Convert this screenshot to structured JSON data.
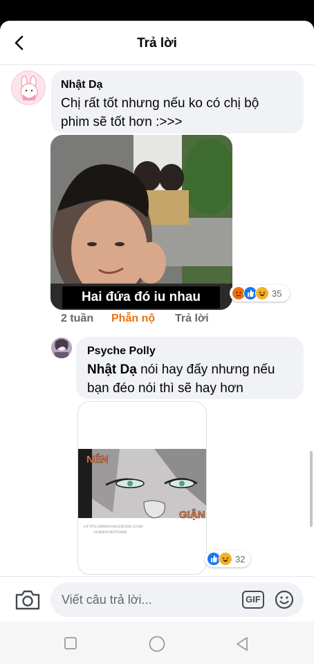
{
  "header": {
    "title": "Trả lời"
  },
  "comment1": {
    "author": "Nhật Dạ",
    "text_line1": "Chị rất tốt nhưng nếu ko có chị bộ",
    "text_line2": "phim sẽ tốt hơn :>>>",
    "gif_caption": "Hai đứa đó iu nhau",
    "reactions": [
      "angry",
      "like",
      "haha"
    ],
    "reaction_count": "35",
    "time": "2 tuần",
    "reaction_label": "Phẫn nộ",
    "reply_label": "Trả lời"
  },
  "reply1": {
    "author": "Psyche Polly",
    "mention": "Nhật Dạ",
    "text_line1": " nói hay đấy nhưng nếu",
    "text_line2": "bạn đéo nói thì sẽ hay hơn",
    "sticker_text_top": "NÉN",
    "sticker_text_bottom": "GIẬN",
    "sticker_watermark_1": "HTTPS://WWW.FACEBOOK.COM/",
    "sticker_watermark_2": "VUANHONGTEAM/",
    "reactions": [
      "like",
      "haha"
    ],
    "reaction_count": "32"
  },
  "composer": {
    "placeholder": "Viết câu trả lời...",
    "gif_label": "GIF"
  },
  "colors": {
    "angry_orange": "#e9710f",
    "like_blue": "#1877f2",
    "haha_yellow": "#f7b125",
    "bubble_gray": "#f0f2f5"
  }
}
